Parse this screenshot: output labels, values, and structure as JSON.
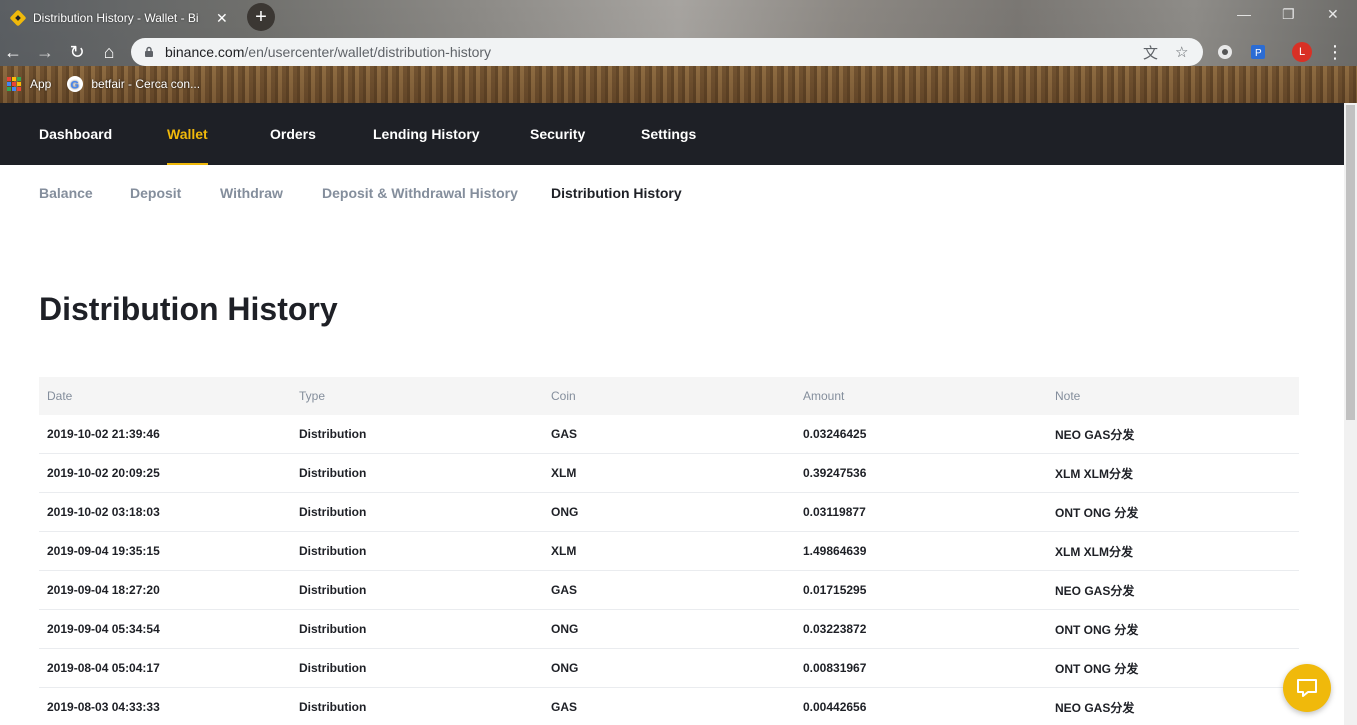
{
  "browser": {
    "tab_title": "Distribution History - Wallet - Bi",
    "url_host": "binance.com",
    "url_path": "/en/usercenter/wallet/distribution-history",
    "bookmarks": [
      {
        "label": "App",
        "icon": "apps-grid-icon"
      },
      {
        "label": "betfair - Cerca con...",
        "icon": "google-icon"
      }
    ],
    "profile_initial": "L"
  },
  "topnav": {
    "items": [
      {
        "label": "Dashboard"
      },
      {
        "label": "Wallet"
      },
      {
        "label": "Orders"
      },
      {
        "label": "Lending History"
      },
      {
        "label": "Security"
      },
      {
        "label": "Settings"
      }
    ],
    "active": "Wallet"
  },
  "subnav": {
    "items": [
      {
        "label": "Balance"
      },
      {
        "label": "Deposit"
      },
      {
        "label": "Withdraw"
      },
      {
        "label": "Deposit & Withdrawal History"
      },
      {
        "label": "Distribution History"
      }
    ],
    "active": "Distribution History"
  },
  "page": {
    "title": "Distribution History"
  },
  "table": {
    "headers": [
      "Date",
      "Type",
      "Coin",
      "Amount",
      "Note"
    ],
    "rows": [
      [
        "2019-10-02 21:39:46",
        "Distribution",
        "GAS",
        "0.03246425",
        "NEO GAS分发"
      ],
      [
        "2019-10-02 20:09:25",
        "Distribution",
        "XLM",
        "0.39247536",
        "XLM XLM分发"
      ],
      [
        "2019-10-02 03:18:03",
        "Distribution",
        "ONG",
        "0.03119877",
        "ONT ONG 分发"
      ],
      [
        "2019-09-04 19:35:15",
        "Distribution",
        "XLM",
        "1.49864639",
        "XLM XLM分发"
      ],
      [
        "2019-09-04 18:27:20",
        "Distribution",
        "GAS",
        "0.01715295",
        "NEO GAS分发"
      ],
      [
        "2019-09-04 05:34:54",
        "Distribution",
        "ONG",
        "0.03223872",
        "ONT ONG 分发"
      ],
      [
        "2019-08-04 05:04:17",
        "Distribution",
        "ONG",
        "0.00831967",
        "ONT ONG 分发"
      ],
      [
        "2019-08-03 04:33:33",
        "Distribution",
        "GAS",
        "0.00442656",
        "NEO GAS分发"
      ]
    ]
  },
  "colors": {
    "brand_yellow": "#f0b90b",
    "header_dark": "#1e2026",
    "muted_text": "#848e9c"
  }
}
